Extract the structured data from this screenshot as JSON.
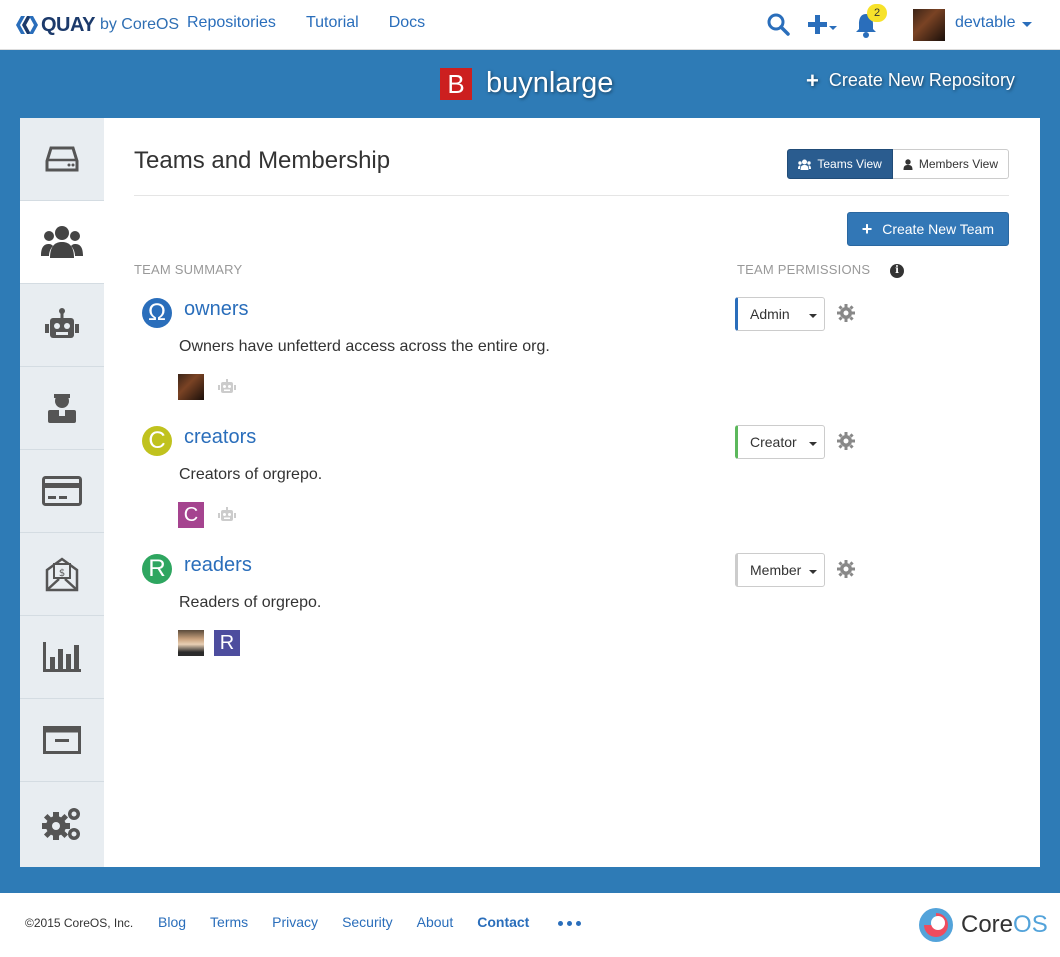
{
  "navbar": {
    "brand": "QUAY",
    "brand_suffix": "by CoreOS",
    "links": [
      "Repositories",
      "Tutorial",
      "Docs"
    ],
    "notification_count": "2",
    "username": "devtable"
  },
  "org": {
    "avatar_letter": "B",
    "name": "buynlarge",
    "create_repo_label": "Create New Repository"
  },
  "main": {
    "title": "Teams and Membership",
    "view_toggle": {
      "teams": "Teams View",
      "members": "Members View",
      "selected": "Teams View"
    },
    "create_team_label": "Create New Team",
    "col_team_summary": "TEAM SUMMARY",
    "col_team_permissions": "TEAM PERMISSIONS",
    "teams": [
      {
        "icon_letter": "Ω",
        "icon_color": "#2a6ebb",
        "name": "owners",
        "description": "Owners have unfetterd access across the entire org.",
        "role": "Admin",
        "role_color": "#2a6ebb"
      },
      {
        "icon_letter": "C",
        "icon_color": "#c0c21e",
        "name": "creators",
        "description": "Creators of orgrepo.",
        "role": "Creator",
        "role_color": "#5cb85c"
      },
      {
        "icon_letter": "R",
        "icon_color": "#2ea660",
        "name": "readers",
        "description": "Readers of orgrepo.",
        "role": "Member",
        "role_color": "#cccccc"
      }
    ],
    "members": {
      "creators_member_letter": "C",
      "readers_member_letter": "R"
    }
  },
  "footer": {
    "copyright": "©2015 CoreOS, Inc.",
    "links": [
      "Blog",
      "Terms",
      "Privacy",
      "Security",
      "About",
      "Contact"
    ],
    "logo_text_core": "Core",
    "logo_text_os": "OS"
  },
  "colors": {
    "band": "#2e7bb6",
    "link": "#2a6ebb",
    "primary_button": "#3277b6",
    "org_avatar": "#cc1f1f"
  }
}
